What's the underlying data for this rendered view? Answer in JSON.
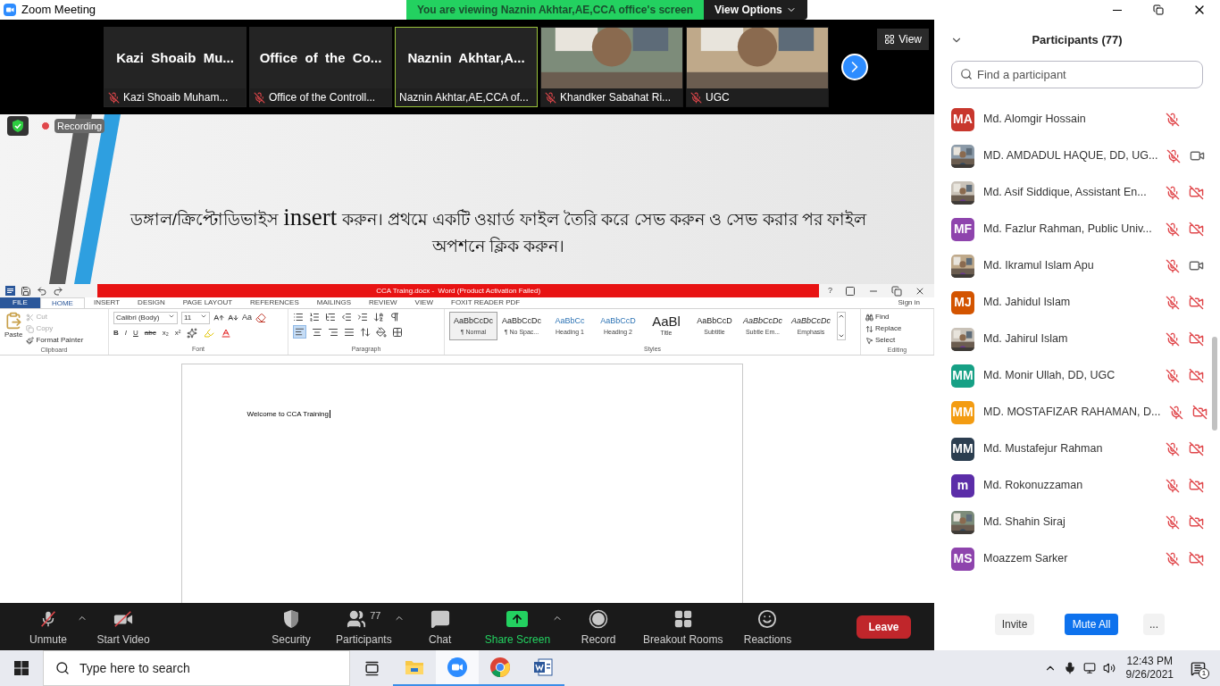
{
  "window": {
    "title": "Zoom Meeting"
  },
  "banner": {
    "text": "You are viewing Naznin Akhtar,AE,CCA office's screen",
    "button": "View Options"
  },
  "tiles": [
    {
      "kind": "name",
      "title": "Kazi  Shoaib  Mu...",
      "label": "Kazi Shoaib Muham...",
      "muted": true,
      "selected": false
    },
    {
      "kind": "name",
      "title": "Office  of  the  Co...",
      "label": "Office of the Controll...",
      "muted": true,
      "selected": false
    },
    {
      "kind": "name",
      "title": "Naznin  Akhtar,A...",
      "label": "Naznin Akhtar,AE,CCA of...",
      "muted": false,
      "selected": true
    },
    {
      "kind": "video",
      "label": "Khandker Sabahat Ri...",
      "muted": true,
      "selected": false
    },
    {
      "kind": "video",
      "label": "UGC",
      "muted": true,
      "selected": false
    }
  ],
  "view_button": "View",
  "recording": {
    "label": "Recording"
  },
  "slide": {
    "before": "ডঙ্গাল/ক্রিপ্টোডিভাইস ",
    "highlight": "insert",
    "after": " করুন। প্রথমে একটি ওয়ার্ড ফাইল তৈরি করে সেভ করুন ও সেভ করার পর ফাইল অপশনে ক্লিক করুন।"
  },
  "word": {
    "title": "CCA Traing.docx -  Word (Product Activation Failed)",
    "help": "?",
    "sign_in": "Sign in",
    "tabs": [
      {
        "kind": "file",
        "label": "FILE",
        "selected": false
      },
      {
        "kind": "tab",
        "label": "HOME",
        "selected": true
      },
      {
        "kind": "tab",
        "label": "INSERT",
        "selected": false
      },
      {
        "kind": "tab",
        "label": "DESIGN",
        "selected": false
      },
      {
        "kind": "tab",
        "label": "PAGE LAYOUT",
        "selected": false
      },
      {
        "kind": "tab",
        "label": "REFERENCES",
        "selected": false
      },
      {
        "kind": "tab",
        "label": "MAILINGS",
        "selected": false
      },
      {
        "kind": "tab",
        "label": "REVIEW",
        "selected": false
      },
      {
        "kind": "tab",
        "label": "VIEW",
        "selected": false
      },
      {
        "kind": "tab",
        "label": "FOXIT READER PDF",
        "selected": false
      }
    ],
    "clipboard": {
      "group": "Clipboard",
      "paste": "Paste",
      "cut": {
        "label": "Cut",
        "disabled": true
      },
      "copy": {
        "label": "Copy",
        "disabled": true
      },
      "format_painter": {
        "label": "Format Painter",
        "disabled": false
      }
    },
    "font": {
      "group": "Font",
      "family": "Calibri (Body)",
      "size": "11",
      "case": "Aa",
      "buttons": [
        "B",
        "I",
        "U",
        "abc",
        "x₂",
        "x²"
      ]
    },
    "paragraph": {
      "group": "Paragraph"
    },
    "styles": {
      "group": "Styles",
      "items": [
        {
          "sample": "AaBbCcDc",
          "name": "¶ Normal",
          "selected": true
        },
        {
          "sample": "AaBbCcDc",
          "name": "¶ No Spac...",
          "selected": false
        },
        {
          "sample": "AaBbCc",
          "name": "Heading 1",
          "selected": false
        },
        {
          "sample": "AaBbCcD",
          "name": "Heading 2",
          "selected": false
        },
        {
          "sample": "AaBl",
          "name": "Title",
          "selected": false
        },
        {
          "sample": "AaBbCcD",
          "name": "Subtitle",
          "selected": false
        },
        {
          "sample": "AaBbCcDc",
          "name": "Subtle Em...",
          "selected": false
        },
        {
          "sample": "AaBbCcDc",
          "name": "Emphasis",
          "selected": false
        }
      ]
    },
    "editing": {
      "group": "Editing",
      "find": "Find",
      "replace": "Replace",
      "select": "Select"
    },
    "document": {
      "text": "Welcome to CCA Training"
    }
  },
  "toolbar": {
    "items": [
      {
        "kind": "unmute",
        "label": "Unmute",
        "caret": true
      },
      {
        "kind": "video",
        "label": "Start Video",
        "caret": false
      },
      {
        "kind": "security",
        "label": "Security",
        "caret": false
      },
      {
        "kind": "participants",
        "label": "Participants",
        "count": "77",
        "caret": true
      },
      {
        "kind": "chat",
        "label": "Chat",
        "caret": false
      },
      {
        "kind": "share",
        "label": "Share Screen",
        "caret": true
      },
      {
        "kind": "record",
        "label": "Record",
        "caret": false
      },
      {
        "kind": "breakout",
        "label": "Breakout Rooms",
        "caret": false
      },
      {
        "kind": "reactions",
        "label": "Reactions",
        "caret": false
      }
    ],
    "leave": "Leave"
  },
  "participants": {
    "title": "Participants (77)",
    "search": {
      "placeholder": "Find a participant"
    },
    "items": [
      {
        "kind": "initials",
        "name": "Md. Alomgir Hossain",
        "initials": "MA",
        "color": "#c8372d",
        "muted": true
      },
      {
        "kind": "picture",
        "name": "MD. AMDADUL HAQUE, DD, UG...",
        "muted": true,
        "video_off": false
      },
      {
        "kind": "picture",
        "name": "Md. Asif Siddique, Assistant En...",
        "muted": true,
        "video_off": true
      },
      {
        "kind": "initials",
        "name": "Md. Fazlur Rahman, Public Univ...",
        "initials": "MF",
        "color": "#8e44ad",
        "muted": true,
        "video_off": true
      },
      {
        "kind": "picture",
        "name": "Md. Ikramul Islam Apu",
        "muted": true,
        "video_off": false
      },
      {
        "kind": "initials",
        "name": "Md. Jahidul Islam",
        "initials": "MJ",
        "color": "#d35400",
        "muted": true,
        "video_off": true
      },
      {
        "kind": "picture",
        "name": "Md. Jahirul Islam",
        "muted": true,
        "video_off": true
      },
      {
        "kind": "initials",
        "name": "Md. Monir Ullah, DD, UGC",
        "initials": "MM",
        "color": "#16a085",
        "muted": true,
        "video_off": true
      },
      {
        "kind": "initials",
        "name": "MD. MOSTAFIZAR RAHAMAN, D...",
        "initials": "MM",
        "color": "#f39c12",
        "muted": true,
        "video_off": true
      },
      {
        "kind": "initials",
        "name": "Md. Mustafejur Rahman",
        "initials": "MM",
        "color": "#2c3e50",
        "muted": true,
        "video_off": true
      },
      {
        "kind": "initials",
        "name": "Md. Rokonuzzaman",
        "initials": "m",
        "color": "#5b2da8",
        "muted": true,
        "video_off": true
      },
      {
        "kind": "picture",
        "name": "Md. Shahin Siraj",
        "muted": true,
        "video_off": true
      },
      {
        "kind": "initials",
        "name": "Moazzem Sarker",
        "initials": "MS",
        "color": "#8e44ad",
        "muted": true,
        "video_off": true
      }
    ],
    "buttons": [
      {
        "kind": "plain",
        "label": "Invite"
      },
      {
        "kind": "primary",
        "label": "Mute All"
      },
      {
        "kind": "more",
        "label": "..."
      }
    ]
  },
  "taskbar": {
    "search": {
      "placeholder": "Type here to search"
    },
    "apps": [
      {
        "kind": "explorer",
        "selected": false
      },
      {
        "kind": "zoom",
        "selected": true
      },
      {
        "kind": "chrome",
        "selected": false
      },
      {
        "kind": "word",
        "selected": false
      }
    ],
    "time": "12:43 PM",
    "date": "9/26/2021",
    "notifications": "1"
  }
}
